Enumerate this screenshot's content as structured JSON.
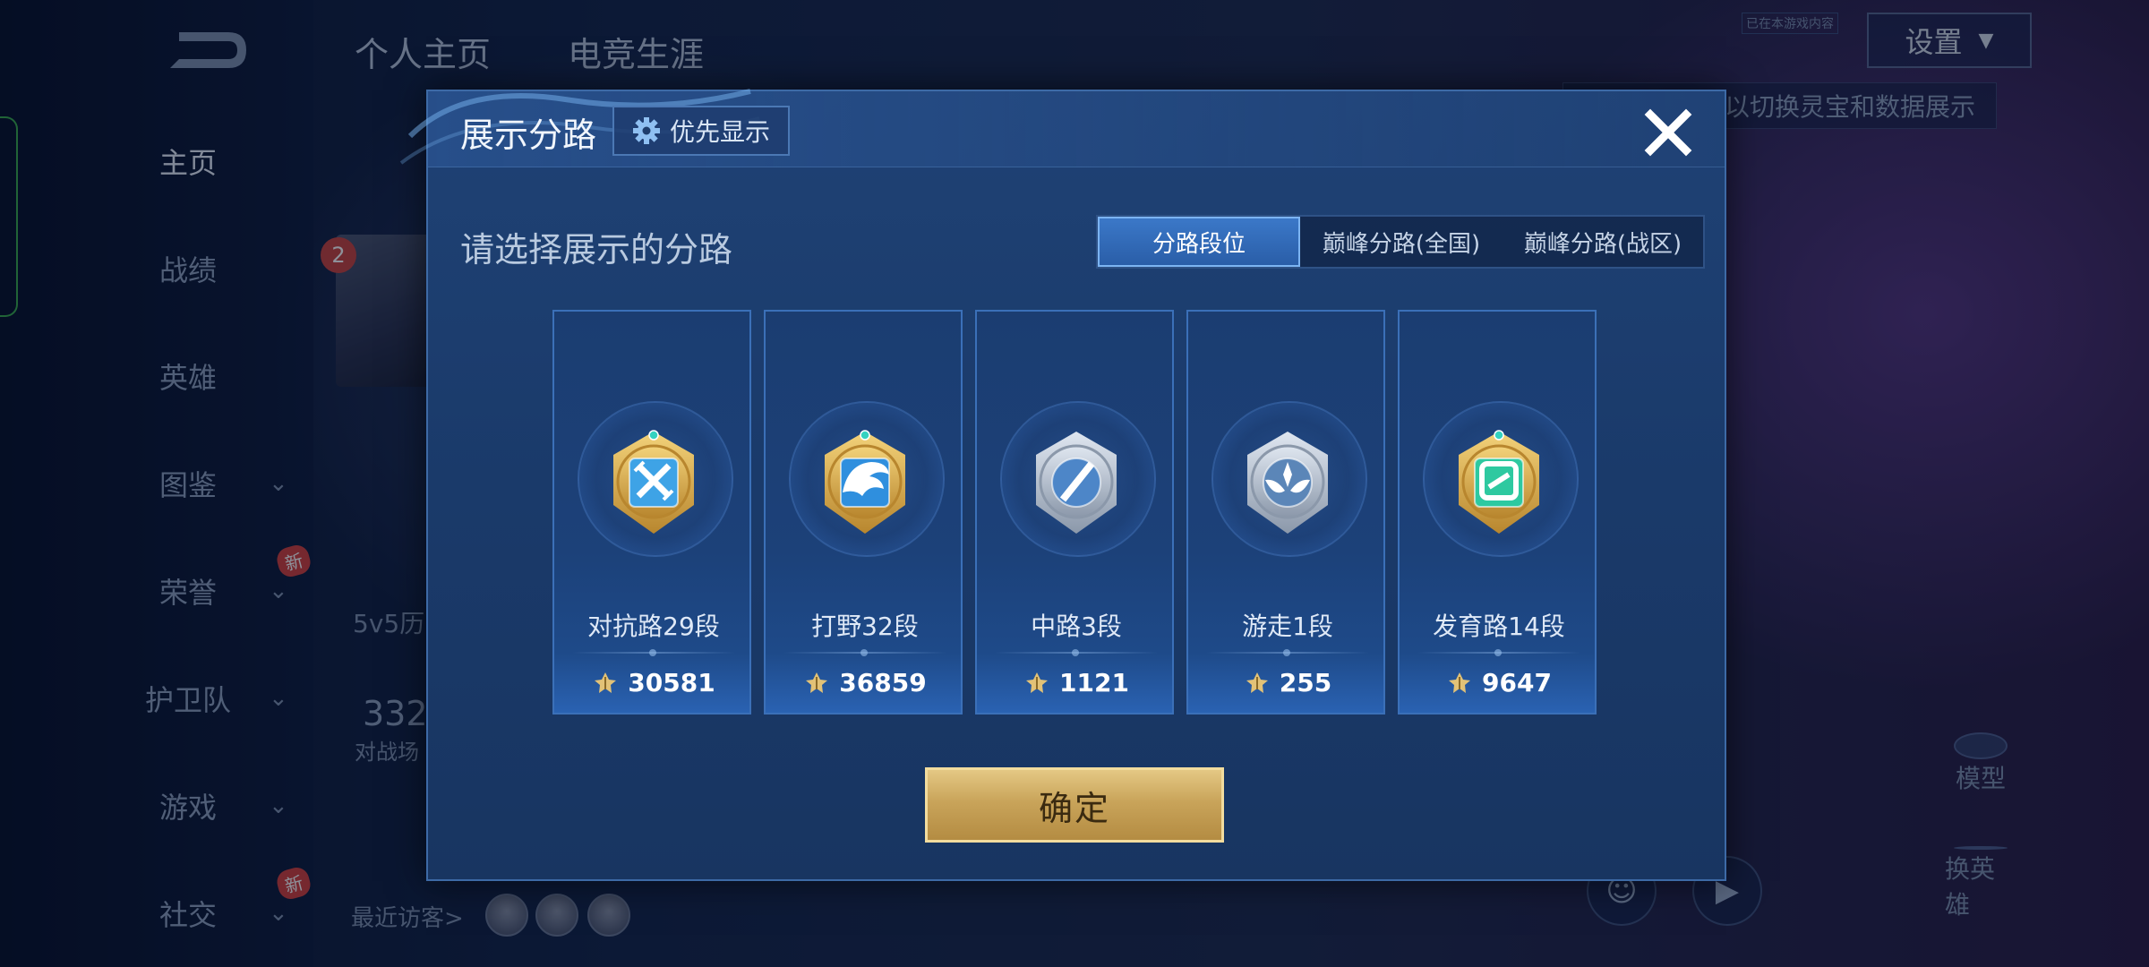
{
  "background": {
    "nav": [
      {
        "label": "主页",
        "active": true,
        "chevron": false,
        "new": false
      },
      {
        "label": "战绩",
        "active": false,
        "chevron": false,
        "new": false
      },
      {
        "label": "英雄",
        "active": false,
        "chevron": false,
        "new": false
      },
      {
        "label": "图鉴",
        "active": false,
        "chevron": true,
        "new": false
      },
      {
        "label": "荣誉",
        "active": false,
        "chevron": true,
        "new": true
      },
      {
        "label": "护卫队",
        "active": false,
        "chevron": true,
        "new": false
      },
      {
        "label": "游戏",
        "active": false,
        "chevron": true,
        "new": false
      },
      {
        "label": "社交",
        "active": false,
        "chevron": true,
        "new": true
      }
    ],
    "new_badge": "新",
    "tabs": [
      "个人主页",
      "电竞生涯"
    ],
    "settings_label": "设置",
    "hint_text": "以切换灵宝和数据展示",
    "tiny_tag": "已在本游戏内容",
    "level_badge": "2",
    "history_text": "5v5历",
    "stat_number": "332",
    "stat_label": "对战场",
    "recent_visitors": "最近访客>",
    "model_label": "模型",
    "switch_hero_label": "换英雄"
  },
  "modal": {
    "title": "展示分路",
    "priority_label": "优先显示",
    "subtitle": "请选择展示的分路",
    "tabs": [
      {
        "label": "分路段位",
        "selected": true
      },
      {
        "label": "巅峰分路(全国)",
        "selected": false
      },
      {
        "label": "巅峰分路(战区)",
        "selected": false
      }
    ],
    "roles": [
      {
        "rank": "对抗路29段",
        "score": "30581",
        "icon": "clash-lane-badge-icon",
        "frame": "gold",
        "color": "#3ea3e6"
      },
      {
        "rank": "打野32段",
        "score": "36859",
        "icon": "jungle-badge-icon",
        "frame": "gold",
        "color": "#2f8fde"
      },
      {
        "rank": "中路3段",
        "score": "1121",
        "icon": "mid-lane-badge-icon",
        "frame": "silver",
        "color": "#4d86c8"
      },
      {
        "rank": "游走1段",
        "score": "255",
        "icon": "roam-badge-icon",
        "frame": "silver",
        "color": "#5b86b8"
      },
      {
        "rank": "发育路14段",
        "score": "9647",
        "icon": "farm-lane-badge-icon",
        "frame": "gold",
        "color": "#2ec9a0"
      }
    ],
    "confirm_label": "确定"
  },
  "colors": {
    "modal_bg": "#1d3e70",
    "tab_selected": "#3b78c8",
    "confirm_gold": "#c9a45a",
    "point_icon": "#e2c277"
  }
}
